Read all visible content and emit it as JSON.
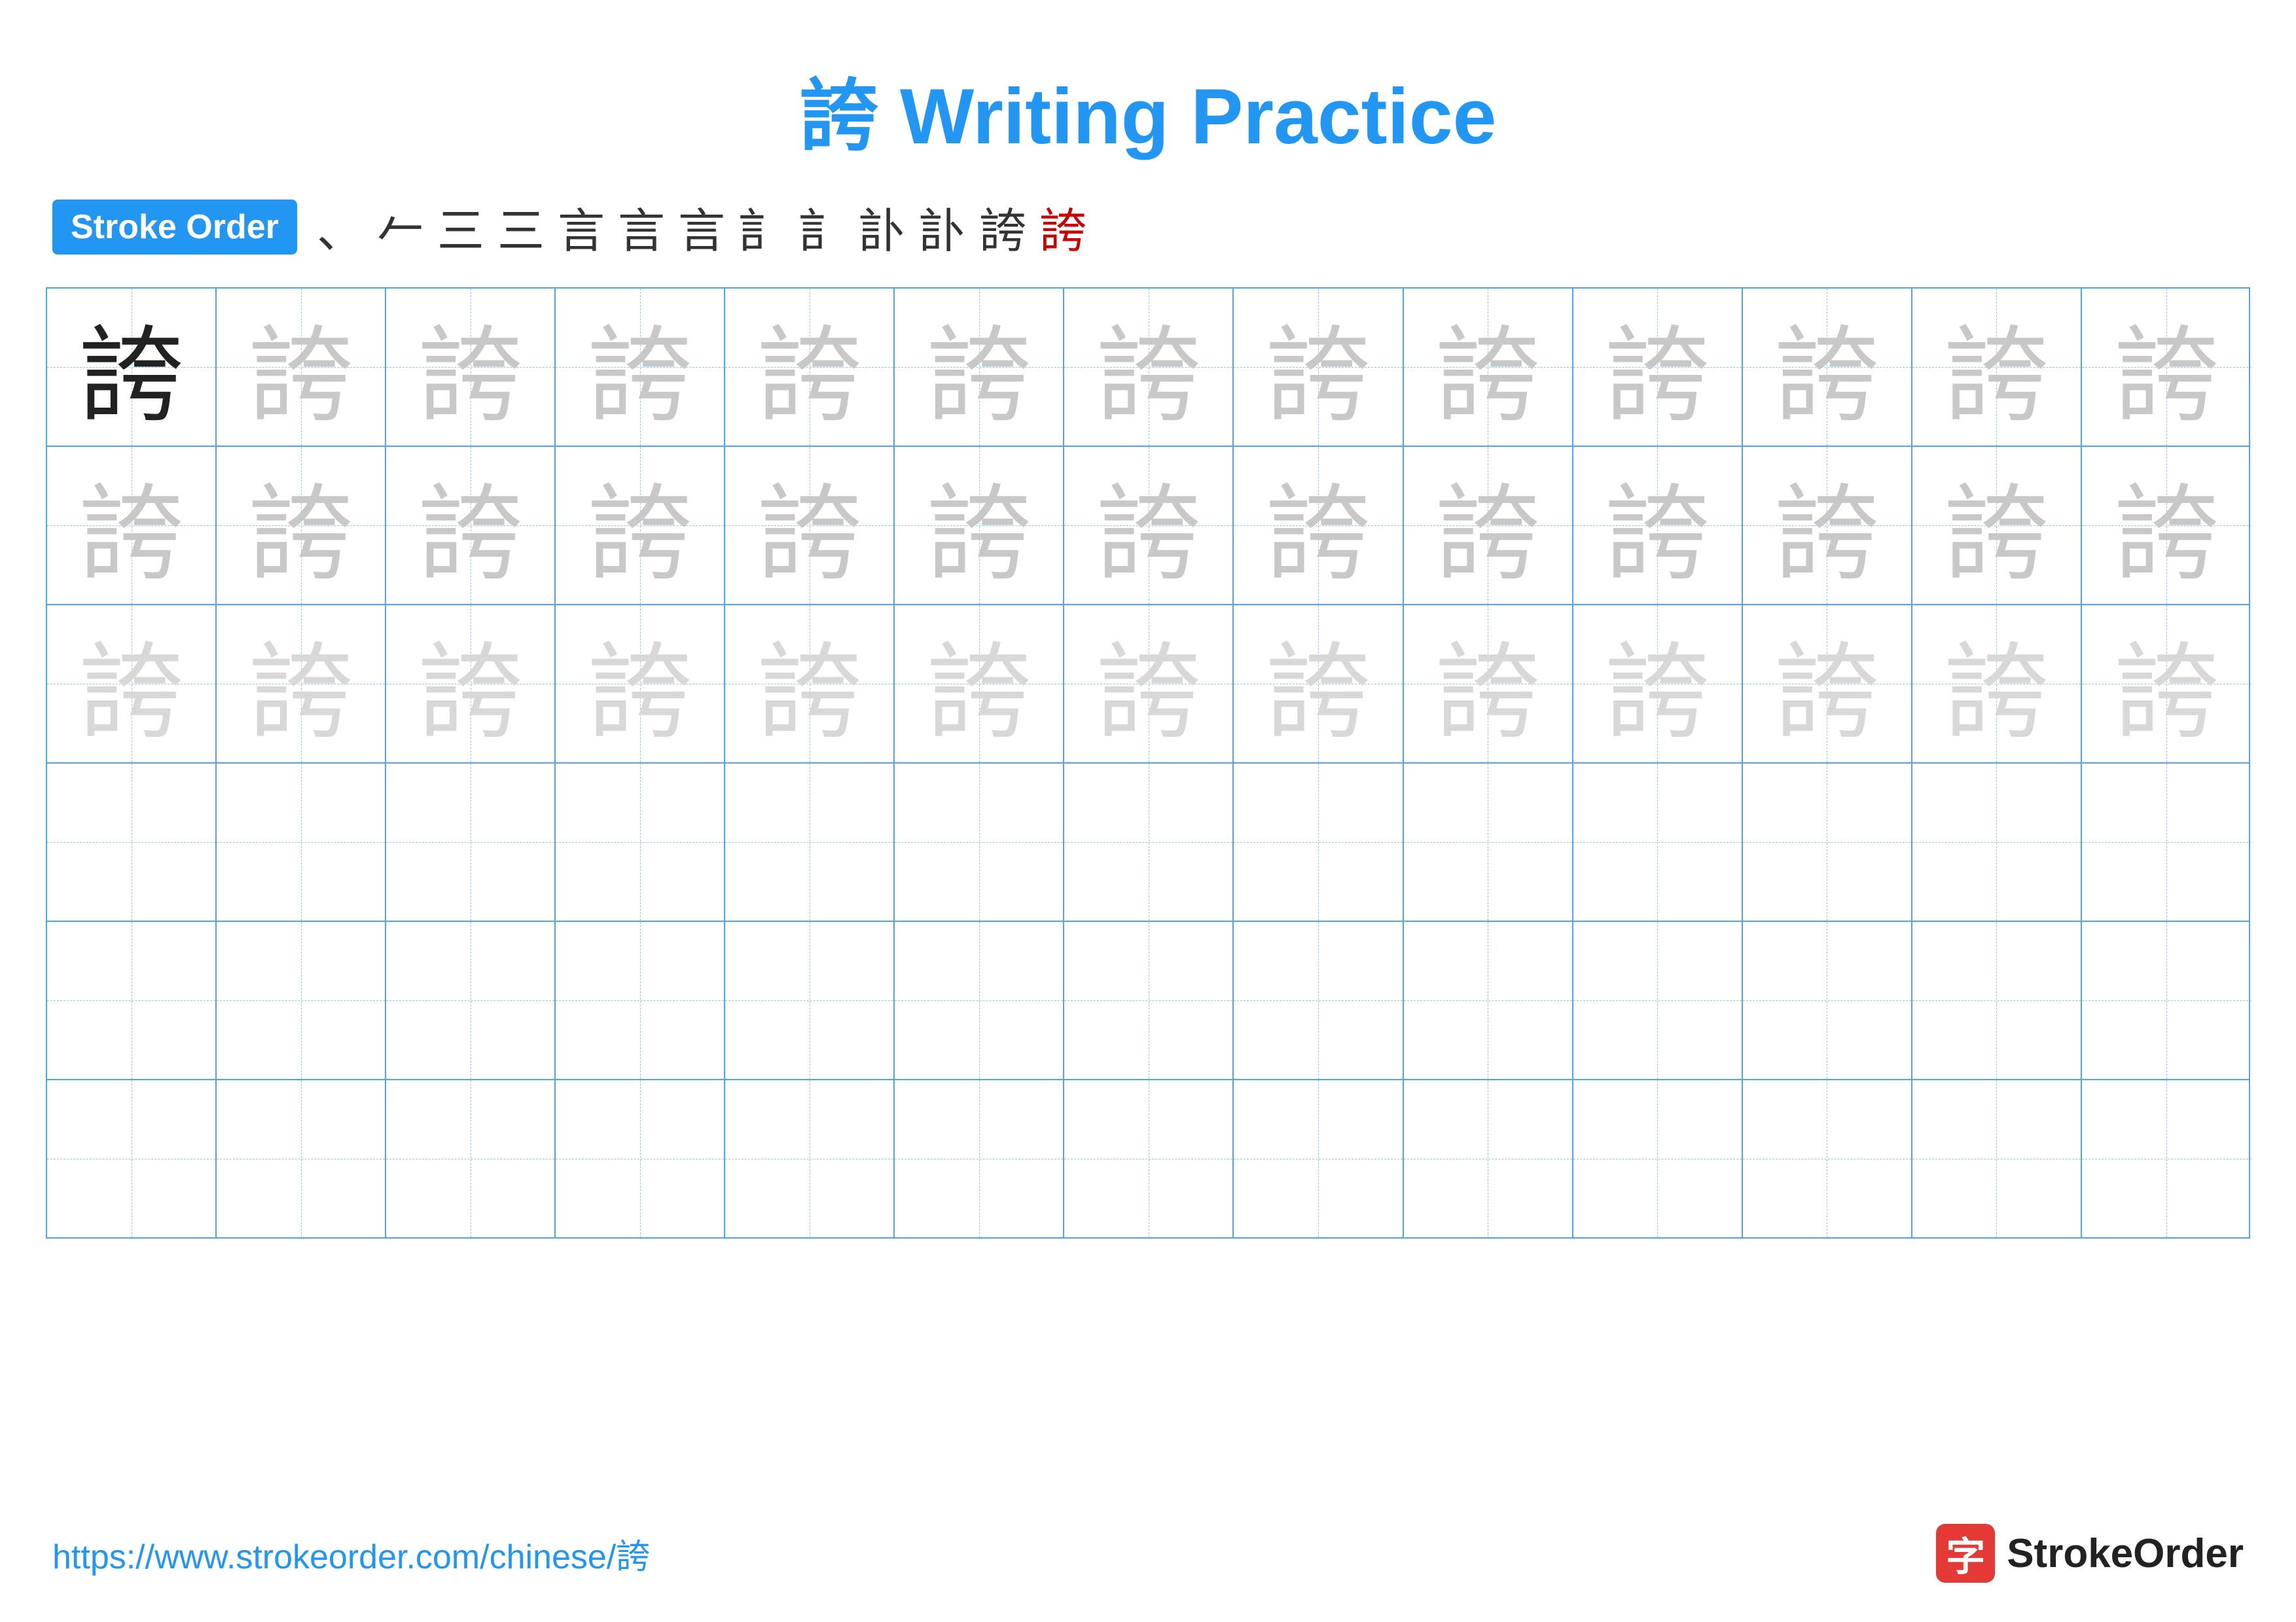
{
  "title": {
    "character": "誇",
    "label": "Writing Practice",
    "full": "誇 Writing Practice"
  },
  "stroke_order": {
    "badge_label": "Stroke Order",
    "strokes": [
      "、",
      "𠂉",
      "三",
      "三",
      "言",
      "言",
      "言",
      "訁",
      "訁",
      "訃",
      "訃",
      "誇",
      "誇"
    ]
  },
  "grid": {
    "rows": 6,
    "cols": 13,
    "character": "誇",
    "row_types": [
      "dark_then_medium",
      "medium",
      "light",
      "empty",
      "empty",
      "empty"
    ]
  },
  "footer": {
    "url": "https://www.strokeorder.com/chinese/誇",
    "brand_name": "StrokeOrder",
    "brand_icon_char": "字"
  }
}
